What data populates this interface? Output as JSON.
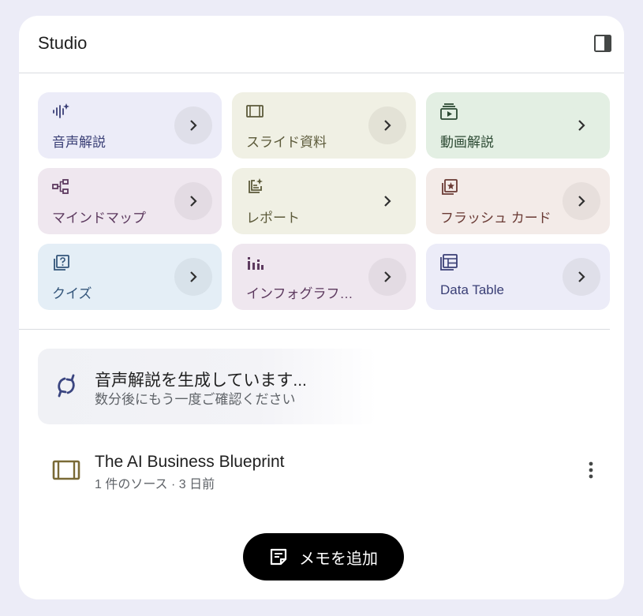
{
  "panel": {
    "title": "Studio"
  },
  "tiles": [
    {
      "label": "音声解説",
      "icon": "audio-overview-icon",
      "bg": "#ececf8",
      "fg": "#3a3f76",
      "arrow_bg": "#dfdfe9"
    },
    {
      "label": "スライド資料",
      "icon": "slides-icon",
      "bg": "#f0f0e4",
      "fg": "#5c5a3a",
      "arrow_bg": "#e3e2d6"
    },
    {
      "label": "動画解説",
      "icon": "video-overview-icon",
      "bg": "#e3efe3",
      "fg": "#2c4a33",
      "arrow_bg": "#e3efe3"
    },
    {
      "label": "マインドマップ",
      "icon": "mind-map-icon",
      "bg": "#efe7ef",
      "fg": "#5d3a5f",
      "arrow_bg": "#e3dbe3"
    },
    {
      "label": "レポート",
      "icon": "report-icon",
      "bg": "#f0f0e4",
      "fg": "#5c5a3a",
      "arrow_bg": "#f0f0e4"
    },
    {
      "label": "フラッシュ カード",
      "icon": "flashcards-icon",
      "bg": "#f3ebe8",
      "fg": "#6a3a34",
      "arrow_bg": "#e7dfdc"
    },
    {
      "label": "クイズ",
      "icon": "quiz-icon",
      "bg": "#e4eef6",
      "fg": "#33557a",
      "arrow_bg": "#d8e2ea"
    },
    {
      "label": "インフォグラフ…",
      "icon": "infographic-icon",
      "bg": "#efe7ef",
      "fg": "#5d3a5f",
      "arrow_bg": "#e3dbe3"
    },
    {
      "label": "Data Table",
      "icon": "data-table-icon",
      "bg": "#ececf8",
      "fg": "#3a3f76",
      "arrow_bg": "#dfdfe9"
    }
  ],
  "generating": {
    "title": "音声解説を生成しています...",
    "subtitle": "数分後にもう一度ご確認ください"
  },
  "note": {
    "title": "The AI Business Blueprint",
    "meta": "1 件のソース · 3 日前",
    "icon": "slides-icon",
    "icon_color": "#7a6a36"
  },
  "add_note": {
    "label": "メモを追加"
  }
}
